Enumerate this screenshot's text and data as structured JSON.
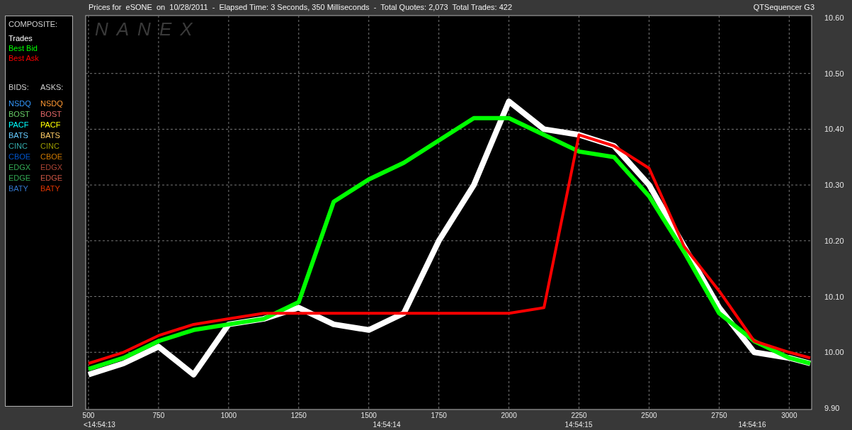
{
  "title_bar": {
    "title": "Prices for  eSONE  on  10/28/2011  -  Elapsed Time: 3 Seconds, 350 Milliseconds  -  Total Quotes: 2,073  Total Trades: 422",
    "app_name": "QTSequencer G3"
  },
  "legend": {
    "composite_heading": "COMPOSITE:",
    "bids_heading": "BIDS:",
    "asks_heading": "ASKS:",
    "bids": [
      {
        "label": "NSDQ",
        "color": "#3399ff"
      },
      {
        "label": "BOST",
        "color": "#66cc66"
      },
      {
        "label": "PACF",
        "color": "#00ffff"
      },
      {
        "label": "BATS",
        "color": "#66ccff"
      },
      {
        "label": "CINC",
        "color": "#33aaaa"
      },
      {
        "label": "CBOE",
        "color": "#0055cc"
      },
      {
        "label": "EDGX",
        "color": "#33aa55"
      },
      {
        "label": "EDGE",
        "color": "#33aa55"
      },
      {
        "label": "BATY",
        "color": "#3377cc"
      }
    ],
    "asks": [
      {
        "label": "NSDQ",
        "color": "#ff9933"
      },
      {
        "label": "BOST",
        "color": "#e06666"
      },
      {
        "label": "PACF",
        "color": "#ffff00"
      },
      {
        "label": "BATS",
        "color": "#ffcc66"
      },
      {
        "label": "CINC",
        "color": "#999900"
      },
      {
        "label": "CBOE",
        "color": "#cc7700"
      },
      {
        "label": "EDGX",
        "color": "#aa4433"
      },
      {
        "label": "EDGE",
        "color": "#cc5544"
      },
      {
        "label": "BATY",
        "color": "#dd3300"
      }
    ]
  },
  "chart": {
    "logo": "NANEX",
    "chart_data": {
      "type": "line",
      "grid": true,
      "xlim": [
        490,
        3080
      ],
      "ylim": [
        9.9,
        10.6
      ],
      "xticks": [
        500,
        750,
        1000,
        1250,
        1500,
        1750,
        2000,
        2250,
        2500,
        2750,
        3000
      ],
      "yticks": [
        {
          "value": 9.9,
          "label": "9.90"
        },
        {
          "value": 10.0,
          "label": "10.00"
        },
        {
          "value": 10.1,
          "label": "10.10"
        },
        {
          "value": 10.2,
          "label": "10.20"
        },
        {
          "value": 10.3,
          "label": "10.30"
        },
        {
          "value": 10.4,
          "label": "10.40"
        },
        {
          "value": 10.5,
          "label": "10.50"
        },
        {
          "value": 10.6,
          "label": "10.60"
        }
      ],
      "x": [
        500,
        625,
        750,
        875,
        1000,
        1125,
        1250,
        1375,
        1500,
        1625,
        1750,
        1875,
        2000,
        2125,
        2250,
        2375,
        2500,
        2625,
        2750,
        2875,
        3000,
        3075
      ],
      "series": [
        {
          "name": "Trades",
          "color": "#ffffff",
          "values": [
            9.96,
            9.98,
            10.01,
            9.96,
            10.05,
            10.06,
            10.08,
            10.05,
            10.04,
            10.07,
            10.2,
            10.3,
            10.45,
            10.4,
            10.39,
            10.37,
            10.3,
            10.19,
            10.08,
            10.0,
            9.99,
            9.98
          ]
        },
        {
          "name": "Best Bid",
          "color": "#00ff00",
          "values": [
            9.97,
            9.99,
            10.02,
            10.04,
            10.05,
            10.06,
            10.09,
            10.27,
            10.31,
            10.34,
            10.38,
            10.42,
            10.42,
            10.39,
            10.36,
            10.35,
            10.28,
            10.18,
            10.07,
            10.02,
            9.99,
            9.98
          ]
        },
        {
          "name": "Best Ask",
          "color": "#ff0000",
          "values": [
            9.98,
            10.0,
            10.03,
            10.05,
            10.06,
            10.07,
            10.07,
            10.07,
            10.07,
            10.07,
            10.07,
            10.07,
            10.07,
            10.08,
            10.39,
            10.37,
            10.33,
            10.19,
            10.11,
            10.02,
            10.0,
            9.99
          ]
        }
      ]
    },
    "time_labels": [
      "<14:54:13",
      "14:54:14",
      "14:54:15",
      "14:54:16"
    ]
  }
}
